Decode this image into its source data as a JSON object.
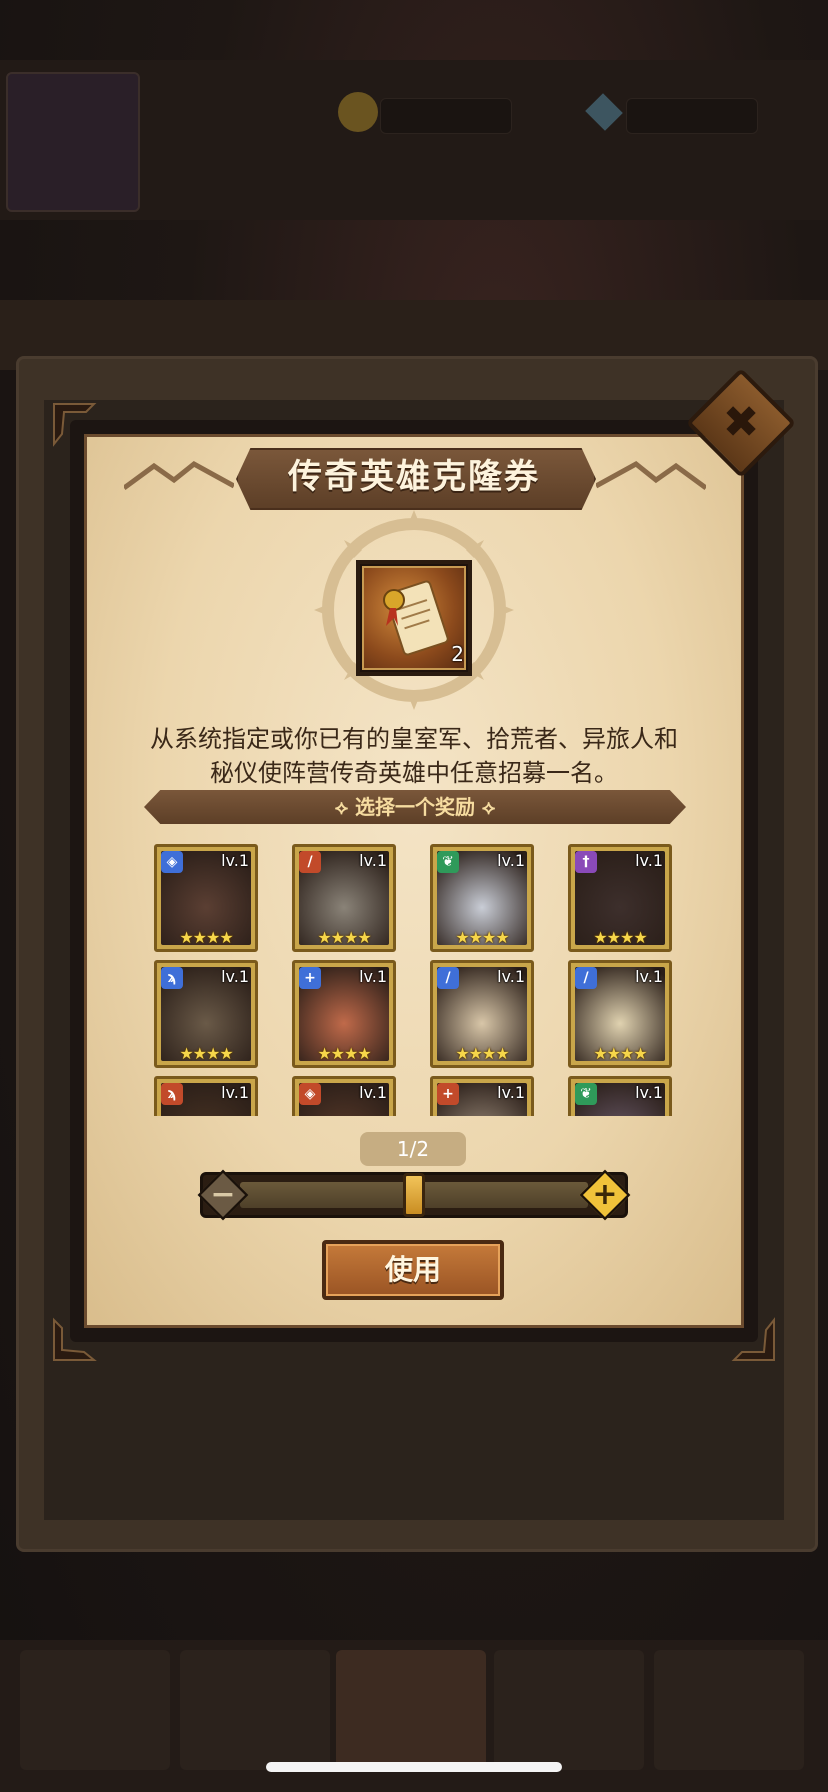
{
  "dialog": {
    "title": "传奇英雄克隆券",
    "close_label": "✖",
    "item": {
      "name": "clone-ticket",
      "count": "2"
    },
    "description_line1": "从系统指定或你已有的皇室军、拾荒者、异旅人和",
    "description_line2": "秘仪使阵营传奇英雄中任意招募一名。",
    "choose_label": "选择一个奖励",
    "page_indicator": "1/2",
    "slider": {
      "minus_label": "−",
      "plus_label": "+",
      "value_fraction": 0.5
    },
    "use_button": "使用"
  },
  "heroes": [
    {
      "level": "lv.1",
      "stars": "★★★★",
      "class_icon": "shield-icon",
      "class_color": "#3f6fd8",
      "skin": "#5b3f33"
    },
    {
      "level": "lv.1",
      "stars": "★★★★",
      "class_icon": "sword-icon",
      "class_color": "#c24a2a",
      "skin": "#8a8378"
    },
    {
      "level": "lv.1",
      "stars": "★★★★",
      "class_icon": "leaf-icon",
      "class_color": "#2f9a5a",
      "skin": "#c9cdd6"
    },
    {
      "level": "lv.1",
      "stars": "★★★★",
      "class_icon": "dagger-icon",
      "class_color": "#8a4ab8",
      "skin": "#3d2f2c"
    },
    {
      "level": "lv.1",
      "stars": "★★★★",
      "class_icon": "bow-icon",
      "class_color": "#3f6fd8",
      "skin": "#6a5a48"
    },
    {
      "level": "lv.1",
      "stars": "★★★★",
      "class_icon": "heal-icon",
      "class_color": "#3f6fd8",
      "skin": "#c06a4a"
    },
    {
      "level": "lv.1",
      "stars": "★★★★",
      "class_icon": "sword-icon",
      "class_color": "#3f6fd8",
      "skin": "#d8c6a8"
    },
    {
      "level": "lv.1",
      "stars": "★★★★",
      "class_icon": "sword-icon",
      "class_color": "#3f6fd8",
      "skin": "#e0d2b0"
    },
    {
      "level": "lv.1",
      "stars": "★★★★",
      "class_icon": "bow-icon",
      "class_color": "#c24a2a",
      "skin": "#4a3424"
    },
    {
      "level": "lv.1",
      "stars": "★★★★",
      "class_icon": "shield-icon",
      "class_color": "#c24a2a",
      "skin": "#5a3a2a"
    },
    {
      "level": "lv.1",
      "stars": "★★★★",
      "class_icon": "heal-icon",
      "class_color": "#c24a2a",
      "skin": "#9a8a7a"
    },
    {
      "level": "lv.1",
      "stars": "★★★★",
      "class_icon": "leaf-icon",
      "class_color": "#2f9a5a",
      "skin": "#6a5a6a"
    }
  ]
}
